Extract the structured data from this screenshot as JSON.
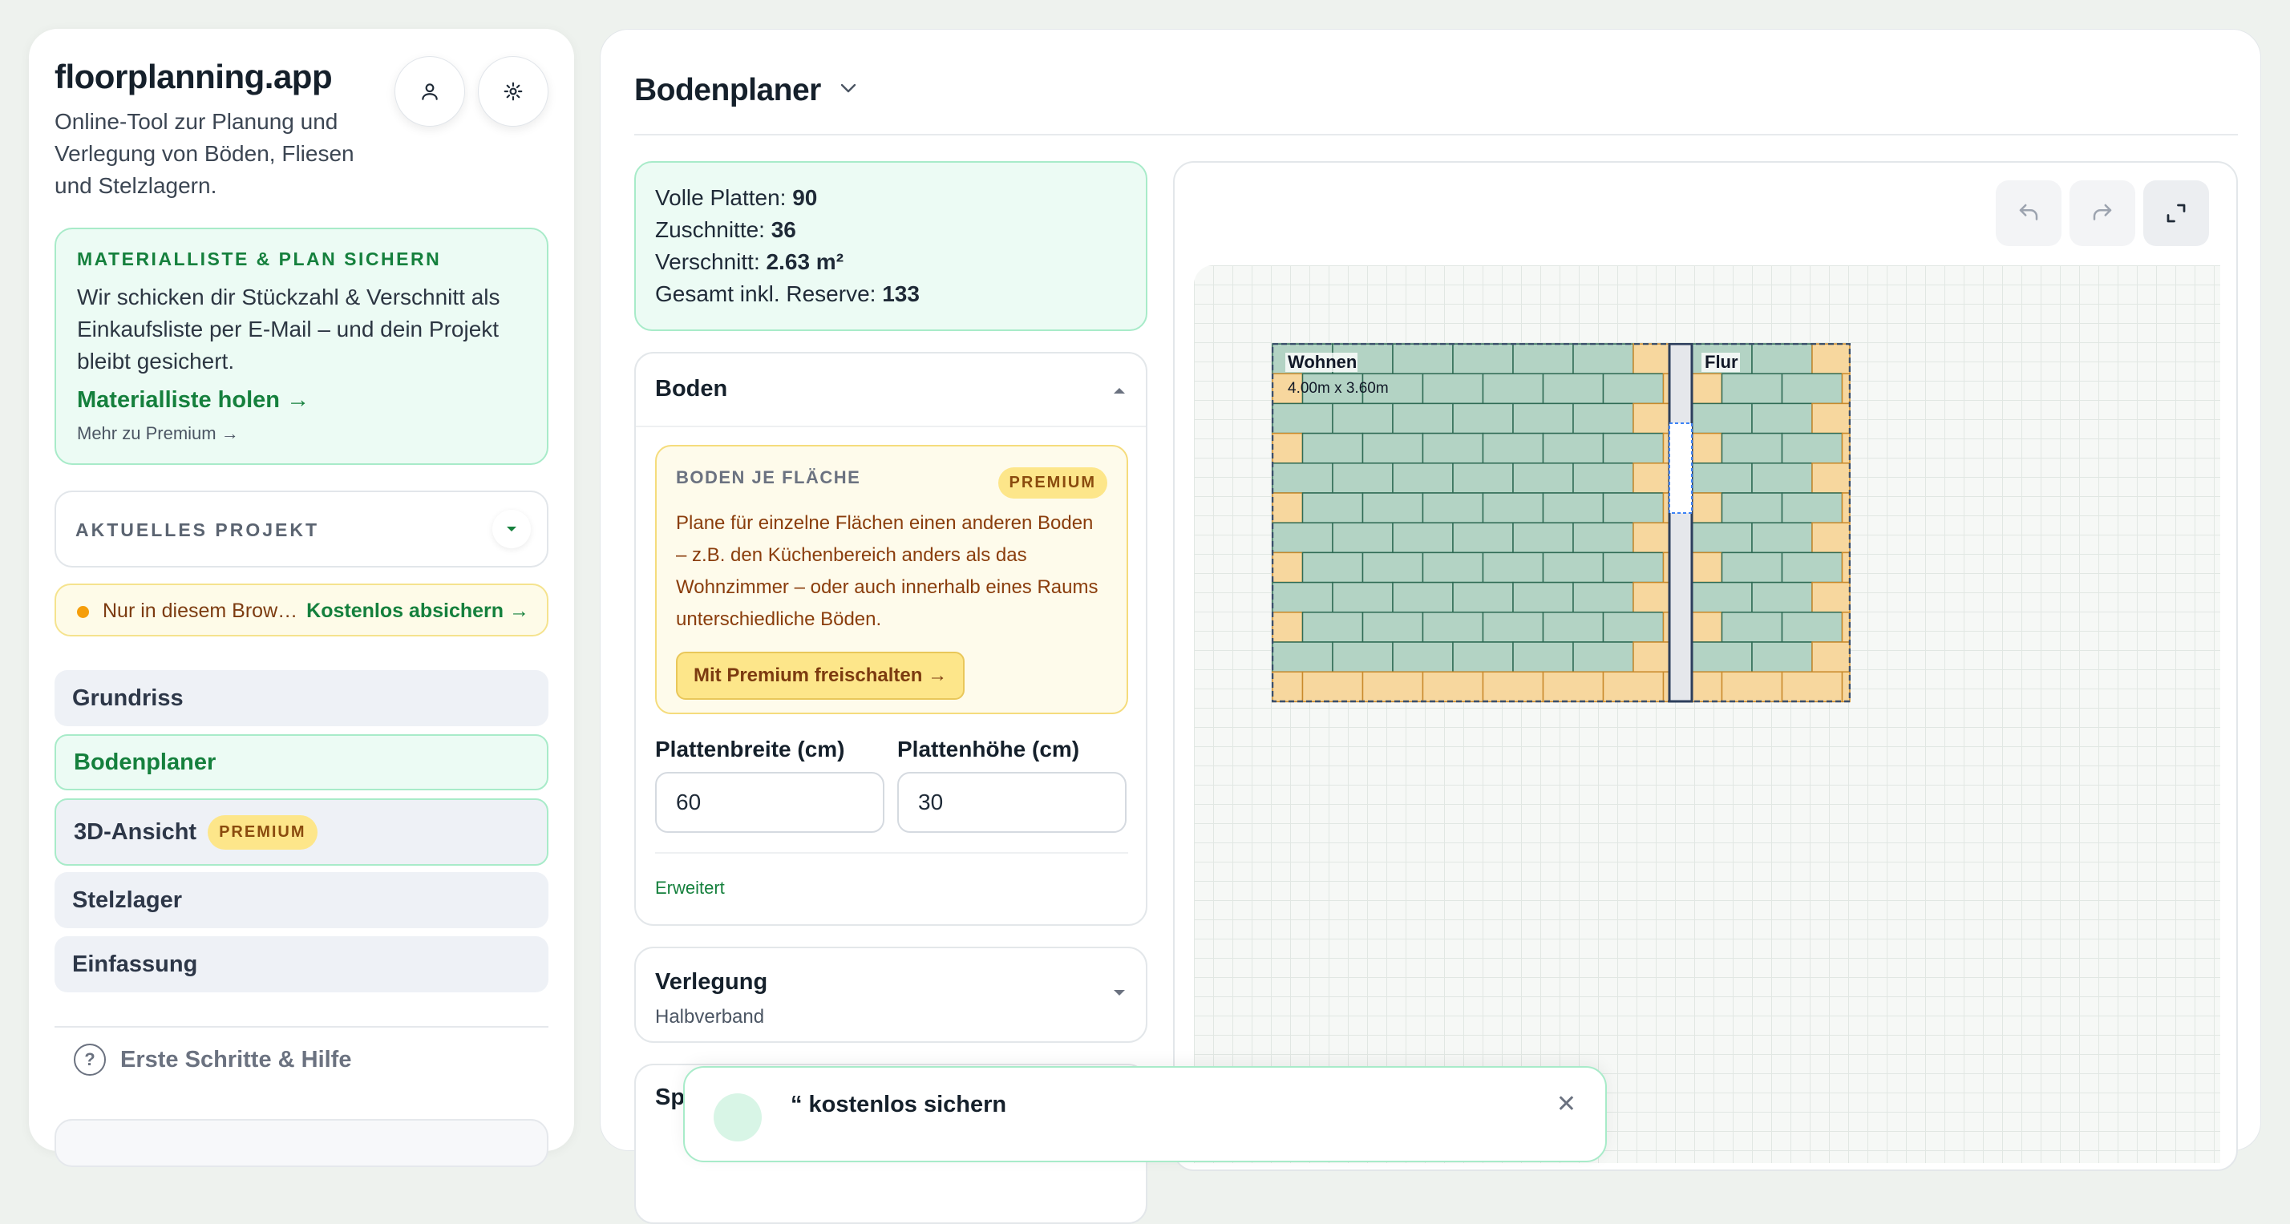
{
  "sidebar": {
    "app_title": "floorplanning.app",
    "app_subtitle": "Online-Tool zur Planung und Verlegung von Böden, Fliesen und Stelzlagern.",
    "promo": {
      "heading": "MATERIALLISTE & PLAN SICHERN",
      "text": "Wir schicken dir Stückzahl & Verschnitt als Einkaufsliste per E-Mail – und dein Projekt bleibt gesichert.",
      "link": "Materialliste holen →",
      "more": "Mehr zu Premium →"
    },
    "project": {
      "label": "AKTUELLES PROJEKT"
    },
    "storage_warning": {
      "text": "Nur in diesem Brow…",
      "link": "Kostenlos absichern →"
    },
    "nav": [
      {
        "label": "Grundriss"
      },
      {
        "label": "Bodenplaner"
      },
      {
        "label": "3D-Ansicht",
        "badge": "PREMIUM"
      },
      {
        "label": "Stelzlager"
      },
      {
        "label": "Einfassung"
      }
    ],
    "help": {
      "label": "Erste Schritte & Hilfe",
      "icon_glyph": "?"
    }
  },
  "main": {
    "title": "Bodenplaner",
    "stats": {
      "full_label": "Volle Platten: ",
      "full_value": "90",
      "cuts_label": "Zuschnitte: ",
      "cuts_value": "36",
      "waste_label": "Verschnitt: ",
      "waste_value": "2.63 m²",
      "total_label": "Gesamt inkl. Reserve: ",
      "total_value": "133"
    },
    "boden": {
      "title": "Boden",
      "premium": {
        "title": "BODEN JE FLÄCHE",
        "badge": "PREMIUM",
        "description": "Plane für einzelne Flächen einen anderen Boden – z.B. den Küchenbereich anders als das Wohnzimmer – oder auch innerhalb eines Raums unterschiedliche Böden.",
        "button": "Mit Premium freischalten →"
      },
      "width_label": "Plattenbreite (cm)",
      "width_value": "60",
      "height_label": "Plattenhöhe (cm)",
      "height_value": "30",
      "advanced": "Erweitert"
    },
    "verlegung": {
      "title": "Verlegung",
      "value": "Halbverband"
    },
    "next_section_label": "Sp"
  },
  "canvas": {
    "rooms": [
      {
        "name": "Wohnen",
        "dimensions": "4.00m x 3.60m"
      },
      {
        "name": "Flur"
      }
    ]
  },
  "toast": {
    "text": "“ kostenlos sichern"
  },
  "colors": {
    "accent_green": "#15803d",
    "full_tile": "#b3d3c4",
    "cut_tile": "#f7d79e",
    "premium": "#fde68a"
  }
}
